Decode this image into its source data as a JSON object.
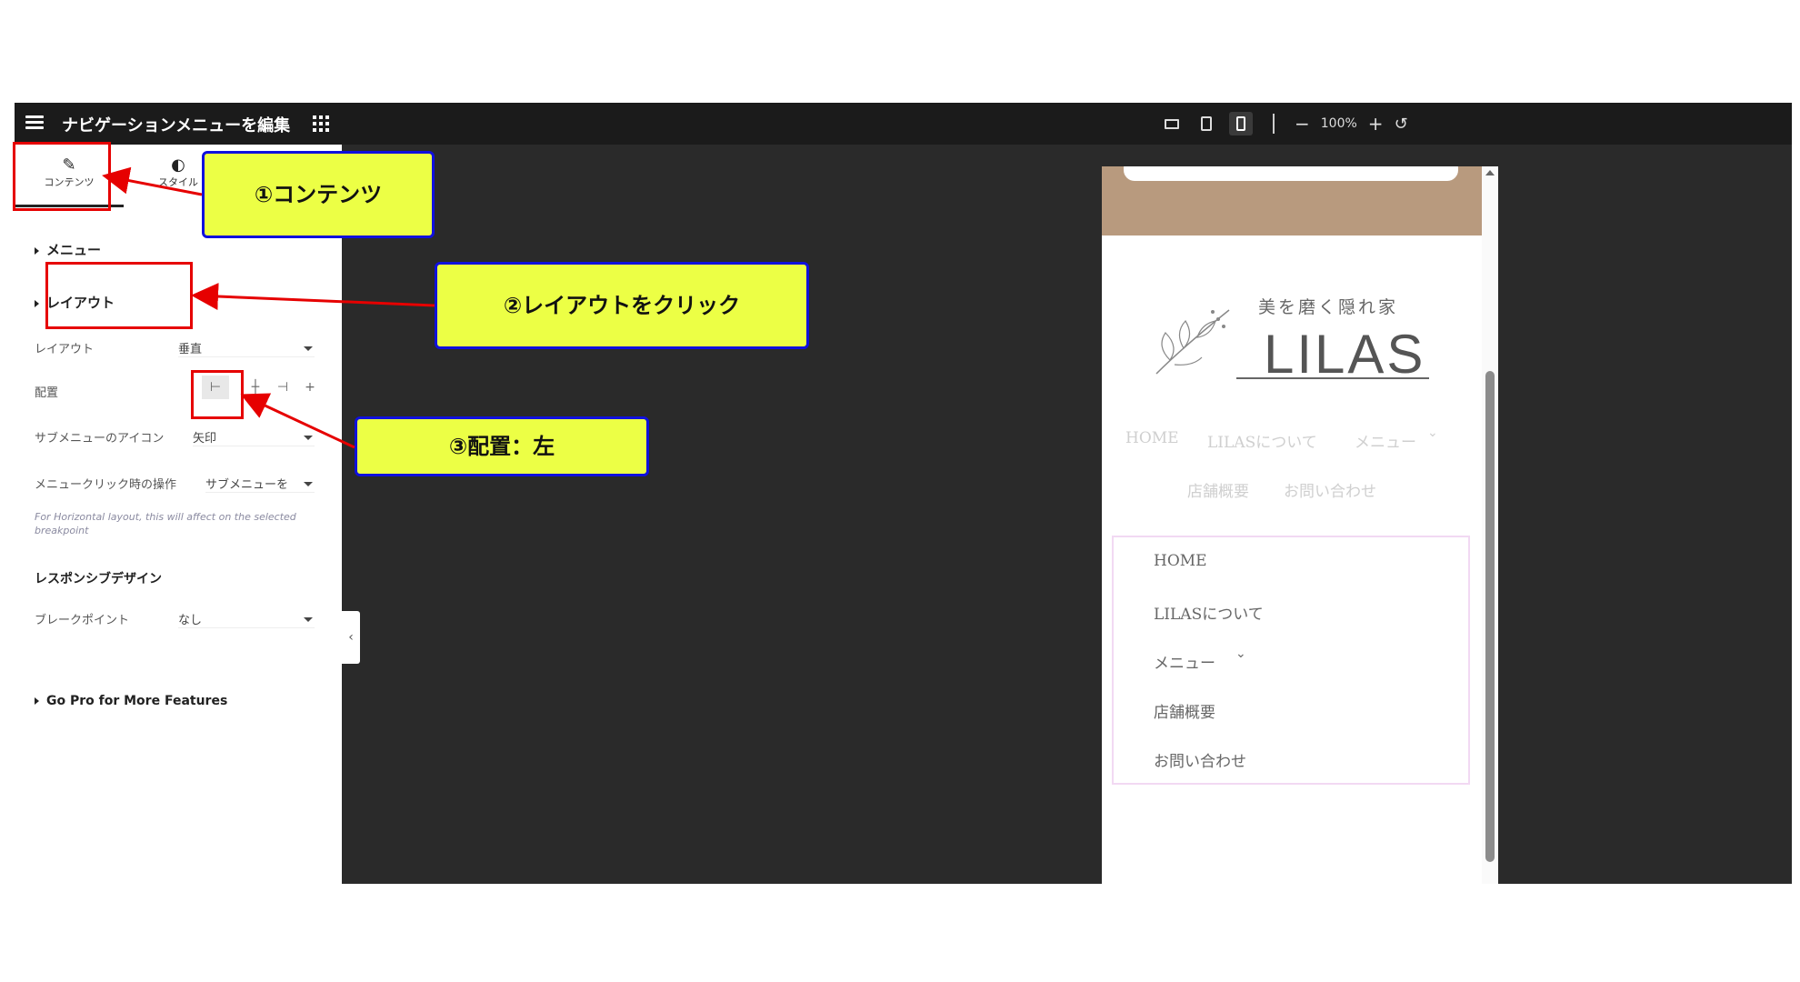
{
  "topbar": {
    "title": "ナビゲーションメニューを編集",
    "zoom": "100%",
    "zoom_minus": "−",
    "zoom_plus": "+",
    "undo": "↺"
  },
  "tabs": {
    "content": "コンテンツ",
    "style": "スタイル"
  },
  "sections": {
    "menu": "メニュー",
    "layout": "レイアウト",
    "responsive": "レスポンシブデザイン",
    "gopro": "Go Pro for More Features"
  },
  "controls": {
    "layout_label": "レイアウト",
    "layout_value": "垂直",
    "align_label": "配置",
    "submenu_icon_label": "サブメニューのアイコン",
    "submenu_icon_value": "矢印",
    "menu_click_label": "メニュークリック時の操作",
    "menu_click_value": "サブメニューを",
    "hint": "For Horizontal layout, this will affect on the selected breakpoint",
    "breakpoint_label": "ブレークポイント",
    "breakpoint_value": "なし"
  },
  "preview": {
    "logo_tagline": "美を磨く隠れ家",
    "logo_name": "LILAS",
    "nav_faded": [
      "HOME",
      "LILASについて",
      "メニュー",
      "店舗概要",
      "お問い合わせ"
    ],
    "menu_items": [
      "HOME",
      "LILASについて",
      "メニュー",
      "店舗概要",
      "お問い合わせ"
    ],
    "chevron": "⌄"
  },
  "callouts": {
    "step1": "①コンテンツ",
    "step2": "②レイアウトをクリック",
    "step3": "③配置：左"
  },
  "colors": {
    "accent_callout": "#ecff45",
    "callout_border": "#1010dd",
    "highlight_red": "#e60000",
    "preview_header": "#b89a7e"
  }
}
